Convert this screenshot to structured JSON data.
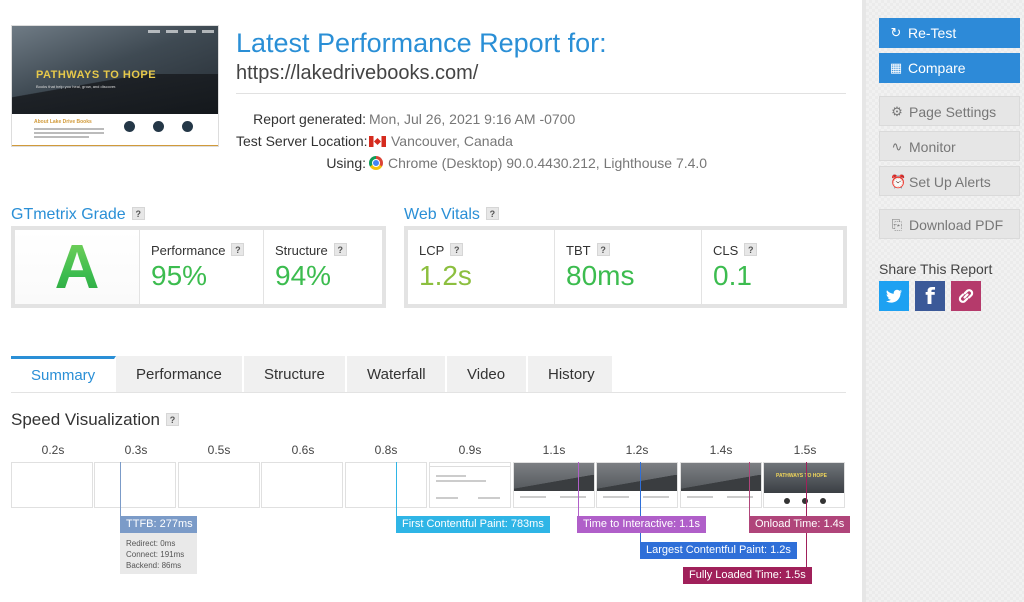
{
  "header": {
    "title": "Latest Performance Report for:",
    "url": "https://lakedrivebooks.com/"
  },
  "thumbnail": {
    "hero_title": "PATHWAYS TO HOPE",
    "hero_tagline": "Books that help you heal, grow, and discover.",
    "about_title": "About Lake Drive Books"
  },
  "meta": {
    "generated_label": "Report generated:",
    "generated_value": "Mon, Jul 26, 2021 9:16 AM -0700",
    "location_label": "Test Server Location:",
    "location_value": "Vancouver, Canada",
    "using_label": "Using:",
    "using_value": "Chrome (Desktop) 90.0.4430.212, Lighthouse 7.4.0"
  },
  "grade": {
    "heading": "GTmetrix Grade",
    "letter": "A",
    "performance_label": "Performance",
    "performance_value": "95%",
    "structure_label": "Structure",
    "structure_value": "94%",
    "color": "#3cbc4f"
  },
  "vitals": {
    "heading": "Web Vitals",
    "lcp_label": "LCP",
    "lcp_value": "1.2s",
    "tbt_label": "TBT",
    "tbt_value": "80ms",
    "cls_label": "CLS",
    "cls_value": "0.1",
    "lcp_color": "#8cbf3f",
    "good_color": "#3cbc4f"
  },
  "tabs": [
    "Summary",
    "Performance",
    "Structure",
    "Waterfall",
    "Video",
    "History"
  ],
  "speed": {
    "title": "Speed Visualization",
    "ticks": [
      "0.2s",
      "0.3s",
      "0.5s",
      "0.6s",
      "0.8s",
      "0.9s",
      "1.1s",
      "1.2s",
      "1.4s",
      "1.5s"
    ],
    "frame_hero_text": "PATHWAYS TO HOPE",
    "ttfb": {
      "label": "TTFB: 277ms",
      "redirect": "Redirect: 0ms",
      "connect": "Connect: 191ms",
      "backend": "Backend: 86ms",
      "color": "#7b9bc8"
    },
    "markers": {
      "fcp": "First Contentful Paint: 783ms",
      "tti": "Time to Interactive: 1.1s",
      "onload": "Onload Time: 1.4s",
      "lcp": "Largest Contentful Paint: 1.2s",
      "fully_loaded": "Fully Loaded Time: 1.5s"
    },
    "colors": {
      "fcp": "#2fb5e6",
      "tti": "#b05fc9",
      "onload": "#b0457a",
      "lcp": "#2f6fd8",
      "fully_loaded": "#a0205a"
    }
  },
  "sidebar": {
    "retest": "Re-Test",
    "compare": "Compare",
    "page_settings": "Page Settings",
    "monitor": "Monitor",
    "alerts": "Set Up Alerts",
    "download": "Download PDF",
    "share_title": "Share This Report",
    "accent": "#2d8ad8",
    "twitter_color": "#1da1f2",
    "facebook_color": "#3b5998",
    "link_color": "#b53a6b"
  }
}
